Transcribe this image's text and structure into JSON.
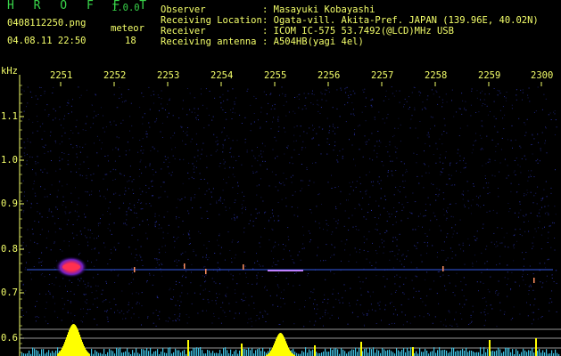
{
  "header": {
    "app_title": "H R O F F T",
    "version": "1.0.0",
    "filename": "0408112250.png",
    "datetime": "04.08.11 22:50",
    "meteor_label": "meteor",
    "meteor_count": "18",
    "observer_label": "Observer",
    "observer_value": ": Masayuki Kobayashi",
    "location_label": "Receiving Location",
    "location_value": ": Ogata-vill. Akita-Pref. JAPAN (139.96E, 40.02N)",
    "receiver_label": "Receiver",
    "receiver_value": ": ICOM IC-575 53.7492(@LCD)MHz USB",
    "antenna_label": "Receiving antenna",
    "antenna_value": ": A504HB(yagi 4el)"
  },
  "axes": {
    "y_unit": "kHz",
    "time_ticks": [
      "2251",
      "2252",
      "2253",
      "2254",
      "2255",
      "2256",
      "2257",
      "2258",
      "2259",
      "2300"
    ],
    "freq_ticks": [
      "1.1",
      "1.0",
      "0.9",
      "0.8",
      "0.7",
      "0.6"
    ]
  },
  "colors": {
    "background": "#000000",
    "text_green": "#39d64a",
    "text_yellow": "#f4ff6a",
    "signal_line": "#3a6cff",
    "meteor_red": "#ff2a4a",
    "histogram_yellow": "#ffff00",
    "histogram_cyan": "#40e0ff"
  }
}
